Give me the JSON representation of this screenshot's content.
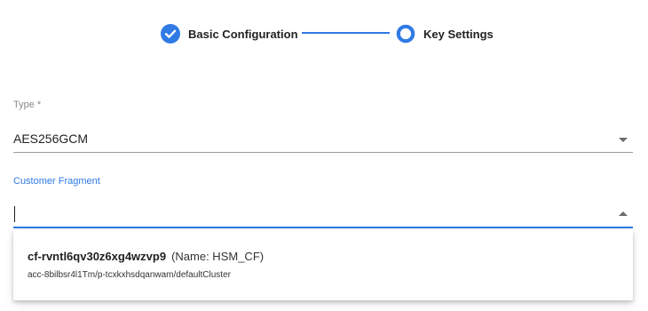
{
  "stepper": {
    "steps": [
      {
        "label": "Basic Configuration",
        "state": "completed",
        "icon": "check-circle-icon"
      },
      {
        "label": "Key Settings",
        "state": "active",
        "icon": "ring-circle-icon"
      }
    ],
    "accent_color": "#2f7ae5"
  },
  "form": {
    "type": {
      "label": "Type *",
      "value": "AES256GCM",
      "icon": "caret-down-icon"
    },
    "customer_fragment": {
      "label": "Customer Fragment",
      "value": "",
      "state": "focused",
      "icon": "caret-up-icon"
    }
  },
  "dropdown": {
    "options": [
      {
        "id": "cf-rvntl6qv30z6xg4wzvp9",
        "name": "(Name: HSM_CF)",
        "path": "acc-8bilbsr4l1Tm/p-tcxkxhsdqanwam/defaultCluster"
      }
    ]
  }
}
